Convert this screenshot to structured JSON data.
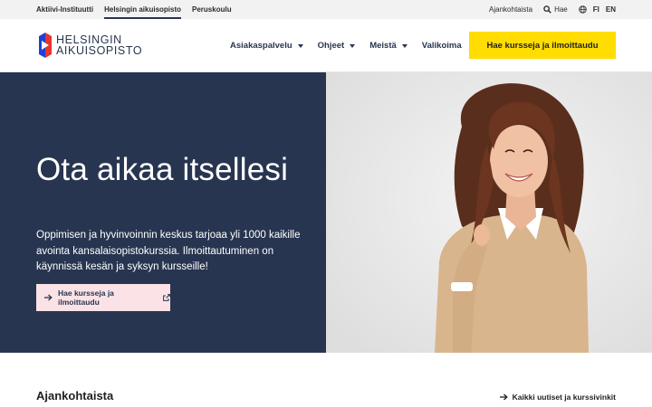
{
  "utility": {
    "tabs": [
      {
        "label": "Aktiivi-Instituutti",
        "active": false
      },
      {
        "label": "Helsingin aikuisopisto",
        "active": true
      },
      {
        "label": "Peruskoulu",
        "active": false
      }
    ],
    "current_label": "Ajankohtaista",
    "search_label": "Hae",
    "languages": [
      "FI",
      "EN"
    ]
  },
  "header": {
    "logo": {
      "line1": "HELSINGIN",
      "line2": "AIKUISOPISTO"
    },
    "nav": [
      {
        "label": "Asiakaspalvelu",
        "has_dropdown": true
      },
      {
        "label": "Ohjeet",
        "has_dropdown": true
      },
      {
        "label": "Meistä",
        "has_dropdown": true
      },
      {
        "label": "Valikoima",
        "has_dropdown": false
      }
    ],
    "cta_label": "Hae kursseja ja ilmoittaudu"
  },
  "hero": {
    "title": "Ota aikaa itsellesi",
    "text": "Oppimisen ja hyvinvoinnin keskus tarjoaa yli 1000 kaikille avointa kansalaisopistokurssia. Ilmoittautuminen on käynnissä kesän ja syksyn kursseille!",
    "button_label": "Hae kursseja ja ilmoittaudu"
  },
  "news": {
    "title": "Ajankohtaista",
    "link_label": "Kaikki uutiset ja kurssivinkit"
  },
  "colors": {
    "navy": "#283550",
    "yellow": "#ffdd00",
    "pink": "#fbe2e6",
    "logo_red": "#e6352b",
    "logo_blue": "#1f3fd6"
  }
}
